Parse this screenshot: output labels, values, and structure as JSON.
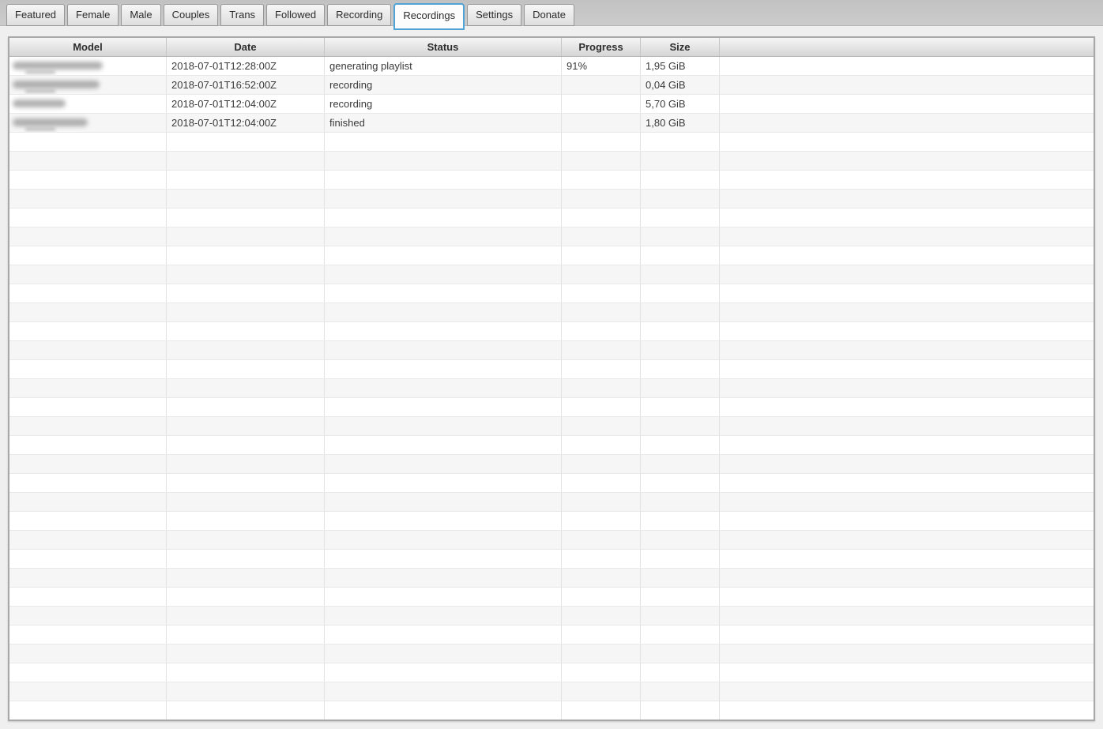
{
  "tabs": {
    "items": [
      {
        "label": "Featured",
        "active": false
      },
      {
        "label": "Female",
        "active": false
      },
      {
        "label": "Male",
        "active": false
      },
      {
        "label": "Couples",
        "active": false
      },
      {
        "label": "Trans",
        "active": false
      },
      {
        "label": "Followed",
        "active": false
      },
      {
        "label": "Recording",
        "active": false
      },
      {
        "label": "Recordings",
        "active": true
      },
      {
        "label": "Settings",
        "active": false
      },
      {
        "label": "Donate",
        "active": false
      }
    ]
  },
  "table": {
    "columns": [
      {
        "id": "model",
        "label": "Model"
      },
      {
        "id": "date",
        "label": "Date"
      },
      {
        "id": "status",
        "label": "Status"
      },
      {
        "id": "progress",
        "label": "Progress"
      },
      {
        "id": "size",
        "label": "Size"
      },
      {
        "id": "filler",
        "label": ""
      }
    ],
    "rows": [
      {
        "model": "",
        "model_redacted": true,
        "blur_width": 114,
        "has_underline": true,
        "date": "2018-07-01T12:28:00Z",
        "status": "generating playlist",
        "progress": "91%",
        "size": "1,95 GiB"
      },
      {
        "model": "",
        "model_redacted": true,
        "blur_width": 110,
        "has_underline": true,
        "date": "2018-07-01T16:52:00Z",
        "status": "recording",
        "progress": "",
        "size": "0,04 GiB"
      },
      {
        "model": "",
        "model_redacted": true,
        "blur_width": 67,
        "has_underline": false,
        "date": "2018-07-01T12:04:00Z",
        "status": "recording",
        "progress": "",
        "size": "5,70 GiB"
      },
      {
        "model": "",
        "model_redacted": true,
        "blur_width": 95,
        "has_underline": true,
        "date": "2018-07-01T12:04:00Z",
        "status": "finished",
        "progress": "",
        "size": "1,80 GiB"
      }
    ],
    "visible_row_count": 35
  },
  "colors": {
    "accent_active_tab_border": "#4fa3d6",
    "tabbar_background": "#c9c9c9",
    "content_background": "#efefef",
    "table_border": "#a8a8a8",
    "header_gradient_top": "#f5f5f5",
    "header_gradient_bottom": "#d6d6d6",
    "row_background": "#ffffff",
    "row_alt_background": "#f6f6f6"
  }
}
